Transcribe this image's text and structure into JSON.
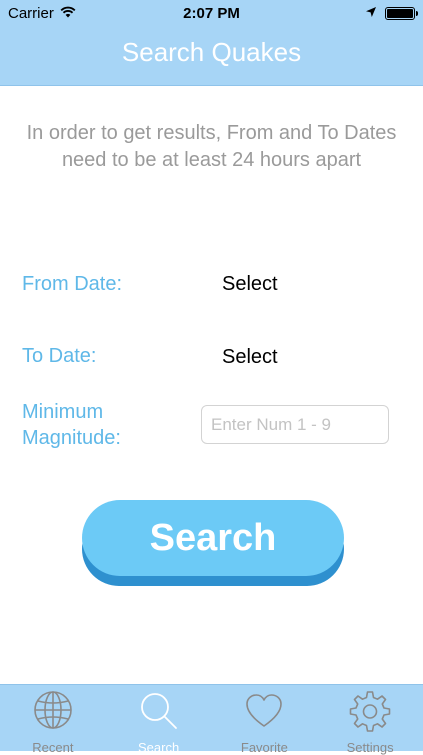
{
  "status_bar": {
    "carrier": "Carrier",
    "time": "2:07 PM"
  },
  "header": {
    "title": "Search Quakes"
  },
  "main": {
    "instructions": "In order to get results, From and To Dates need to be at least 24 hours apart",
    "from_date": {
      "label": "From Date:",
      "value": "Select"
    },
    "to_date": {
      "label": "To Date:",
      "value": "Select"
    },
    "min_magnitude": {
      "label_line1": "Minimum",
      "label_line2": "Magnitude:",
      "placeholder": "Enter Num 1 - 9",
      "value": ""
    },
    "search_button": "Search"
  },
  "tabbar": {
    "active": "Search",
    "tabs": [
      {
        "label": "Recent",
        "icon": "globe-icon"
      },
      {
        "label": "Search",
        "icon": "search-icon"
      },
      {
        "label": "Favorite",
        "icon": "heart-icon"
      },
      {
        "label": "Settings",
        "icon": "gear-icon"
      }
    ]
  },
  "colors": {
    "header_bg": "#a7d5f6",
    "accent_label": "#5fb8e8",
    "button_face": "#6ccaf6",
    "button_shadow": "#2e90cf",
    "tab_inactive": "#8a8a8a",
    "tab_active": "#ffffff"
  }
}
